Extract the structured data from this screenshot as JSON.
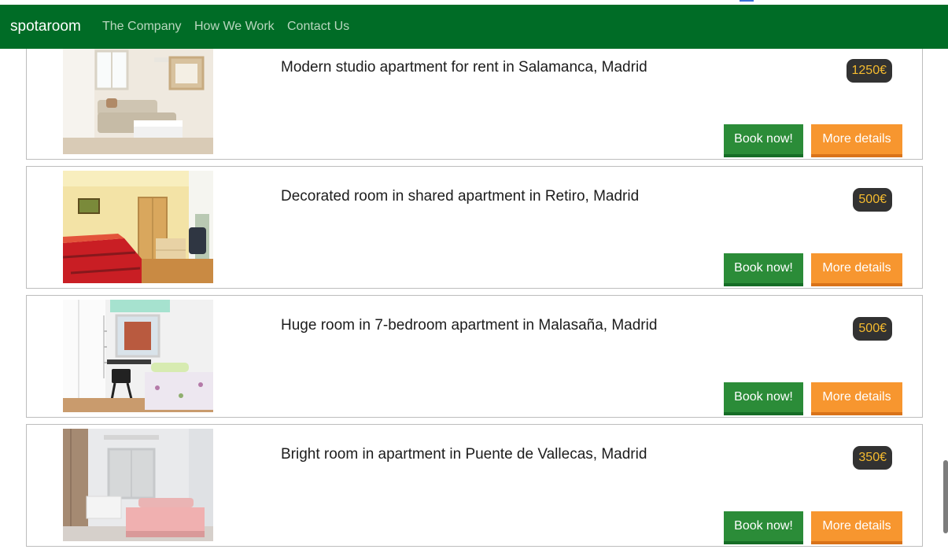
{
  "navbar": {
    "brand": "spotaroom",
    "links": [
      "The Company",
      "How We Work",
      "Contact Us"
    ]
  },
  "listings": [
    {
      "title": "Modern studio apartment for rent in Salamanca, Madrid",
      "price": "1250€",
      "book_label": "Book now!",
      "details_label": "More details"
    },
    {
      "title": "Decorated room in shared apartment in Retiro, Madrid",
      "price": "500€",
      "book_label": "Book now!",
      "details_label": "More details"
    },
    {
      "title": "Huge room in 7-bedroom apartment in Malasaña, Madrid",
      "price": "500€",
      "book_label": "Book now!",
      "details_label": "More details"
    },
    {
      "title": "Bright room in apartment in Puente de Vallecas, Madrid",
      "price": "350€",
      "book_label": "Book now!",
      "details_label": "More details"
    }
  ],
  "colors": {
    "navbar": "#006c26",
    "book_button": "#2b8c38",
    "details_button": "#f7962f",
    "price_badge": "#323232",
    "price_text": "#f5bb2f"
  }
}
